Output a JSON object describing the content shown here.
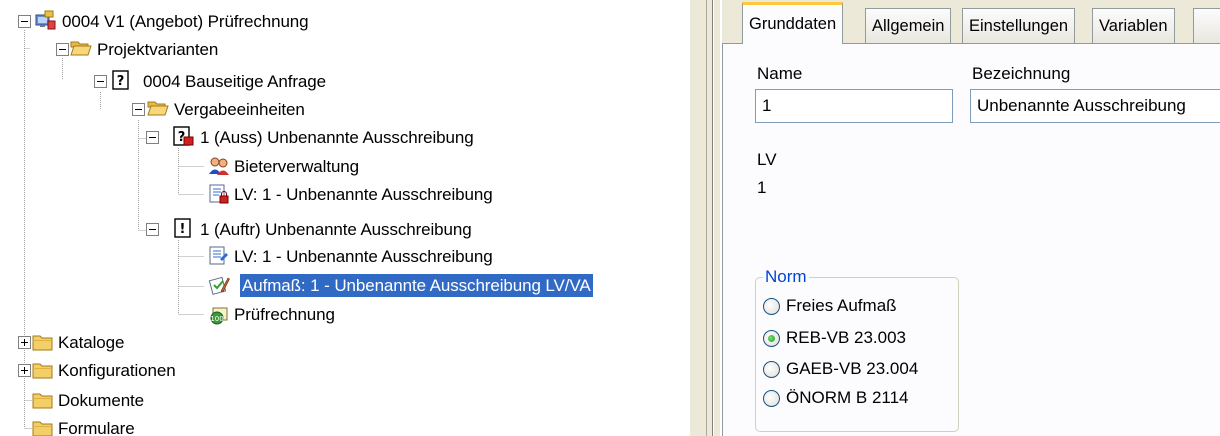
{
  "tree": {
    "root": {
      "label": "0004 V1 (Angebot) Prüfrechnung",
      "icon": "project-computer-icon",
      "expanded": true
    },
    "projektvarianten": {
      "label": "Projektvarianten",
      "icon": "folder-open-icon",
      "expanded": true
    },
    "anfrage": {
      "label": "0004 Bauseitige Anfrage",
      "icon": "question-doc-icon",
      "expanded": true
    },
    "vergabeeinheiten": {
      "label": "Vergabeeinheiten",
      "icon": "folder-open-icon",
      "expanded": true
    },
    "auss": {
      "label": "1 (Auss) Unbenannte Ausschreibung",
      "icon": "tender-doc-icon",
      "expanded": true
    },
    "bieter": {
      "label": "Bieterverwaltung",
      "icon": "bidders-icon"
    },
    "lv_auss": {
      "label": "LV: 1 - Unbenannte Ausschreibung",
      "icon": "lv-doc-locked-icon"
    },
    "auftr": {
      "label": "1 (Auftr) Unbenannte Ausschreibung",
      "icon": "order-doc-icon",
      "expanded": true
    },
    "lv_auftr": {
      "label": "LV: 1 - Unbenannte Ausschreibung",
      "icon": "lv-doc-icon"
    },
    "aufmass": {
      "label": "Aufmaß: 1 - Unbenannte Ausschreibung LV/VA",
      "icon": "measurement-icon",
      "selected": true
    },
    "pruefrechnung": {
      "label": "Prüfrechnung",
      "icon": "invoice-check-icon"
    },
    "kataloge": {
      "label": "Kataloge",
      "icon": "folder-closed-icon",
      "expanded": false
    },
    "konfigurationen": {
      "label": "Konfigurationen",
      "icon": "folder-closed-icon",
      "expanded": false
    },
    "dokumente": {
      "label": "Dokumente",
      "icon": "folder-closed-icon"
    },
    "formulare": {
      "label": "Formulare",
      "icon": "folder-closed-icon"
    }
  },
  "tabs": [
    {
      "label": "Grunddaten",
      "active": true
    },
    {
      "label": "Allgemein",
      "active": false
    },
    {
      "label": "Einstellungen",
      "active": false
    },
    {
      "label": "Variablen",
      "active": false
    }
  ],
  "form": {
    "name_label": "Name",
    "name_value": "1",
    "bezeichnung_label": "Bezeichnung",
    "bezeichnung_value": "Unbenannte Ausschreibung",
    "lv_label": "LV",
    "lv_value": "1",
    "norm": {
      "legend": "Norm",
      "options": [
        {
          "label": "Freies Aufmaß",
          "checked": false
        },
        {
          "label": "REB-VB 23.003",
          "checked": true
        },
        {
          "label": "GAEB-VB 23.004",
          "checked": false
        },
        {
          "label": "ÖNORM B 2114",
          "checked": false
        }
      ]
    }
  },
  "colors": {
    "selection": "#316ac5",
    "group_legend": "#0046d5",
    "active_tab_highlight": "#ffc83c",
    "panel_background": "#ece9d8"
  }
}
